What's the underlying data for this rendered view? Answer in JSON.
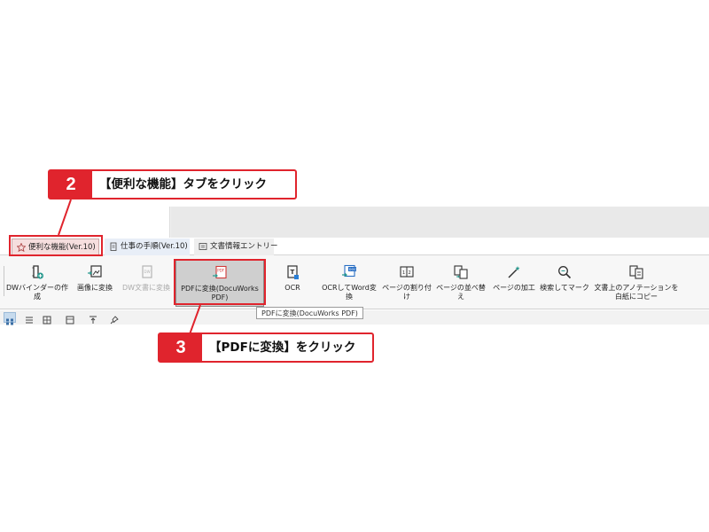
{
  "tabs": [
    {
      "label": "便利な機能(Ver.10)",
      "icon": "star-icon",
      "active": true
    },
    {
      "label": "仕事の手順(Ver.10)",
      "icon": "clipboard-icon",
      "active": false
    },
    {
      "label": "文書情報エントリー",
      "icon": "document-info-icon",
      "active": false
    }
  ],
  "ribbon": {
    "binder": {
      "label": "DWバインダーの作成",
      "icon": "binder-add-icon"
    },
    "image_convert": {
      "label": "画像に変換",
      "icon": "image-convert-icon"
    },
    "dw_convert": {
      "label": "DW文書に変換",
      "icon": "dw-document-icon",
      "disabled": true
    },
    "pdf_convert": {
      "label": "PDFに変換(DocuWorks PDF)",
      "icon": "pdf-convert-icon"
    },
    "ocr": {
      "label": "OCR",
      "icon": "ocr-icon"
    },
    "ocr_word": {
      "label": "OCRしてWord変換",
      "icon": "word-convert-icon"
    },
    "page_split": {
      "label": "ページの割り付け",
      "icon": "page-layout-icon"
    },
    "page_sort": {
      "label": "ページの並べ替え",
      "icon": "page-reorder-icon"
    },
    "page_edit": {
      "label": "ページの加工",
      "icon": "magic-wand-icon"
    },
    "search_mark": {
      "label": "検索してマーク",
      "icon": "search-icon"
    },
    "annotation_copy": {
      "label": "文書上のアノテーションを白紙にコピー",
      "icon": "annotation-copy-icon"
    }
  },
  "tooltip": "PDFに変換(DocuWorks PDF)",
  "callouts": [
    {
      "number": "2",
      "text": "【便利な機能】タブをクリック"
    },
    {
      "number": "3",
      "text": "【PDFに変換】をクリック"
    }
  ],
  "colors": {
    "accent_red": "#e0242d",
    "selected_button": "#cfcfcf",
    "active_tab": "#f6dede"
  }
}
